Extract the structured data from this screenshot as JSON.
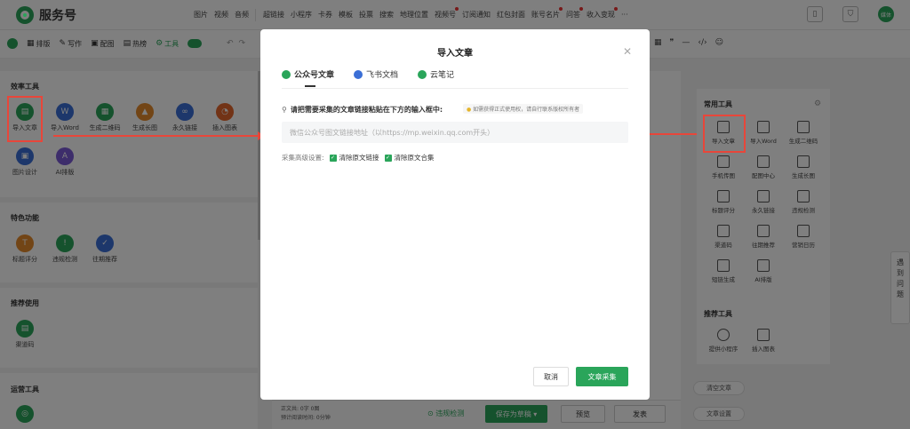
{
  "app": {
    "brand": "服务号"
  },
  "top_menu": [
    "图片",
    "视频",
    "音频",
    "超链接",
    "小程序",
    "卡券",
    "模板",
    "投票",
    "搜索",
    "地理位置",
    "视频号",
    "订阅通知",
    "红包封面",
    "账号名片",
    "问答",
    "收入变现",
    "···"
  ],
  "user": {
    "avatar_text": "媒体"
  },
  "toolbar2": {
    "items": [
      "排版",
      "写作",
      "配图",
      "热榜",
      "工具"
    ]
  },
  "left_panel": {
    "section1_title": "效率工具",
    "section1_tools": [
      "导入文章",
      "导入Word",
      "生成二维码",
      "生成长图",
      "永久链接",
      "插入图表",
      "图片设计",
      "AI排版"
    ],
    "section2_title": "特色功能",
    "section2_tools": [
      "标题评分",
      "违规检测",
      "往期推荐"
    ],
    "section3_title": "推荐使用",
    "section3_tools": [
      "渠道码"
    ],
    "section4_title": "运营工具"
  },
  "right_panel": {
    "title": "常用工具",
    "tools": [
      "导入文章",
      "导入Word",
      "生成二维码",
      "手机传图",
      "配图中心",
      "生成长图",
      "标题评分",
      "永久链接",
      "违规检测",
      "渠道码",
      "往期推荐",
      "营销日历",
      "短链生成",
      "AI排版"
    ],
    "recommend_title": "推荐工具",
    "recommend_tools": [
      "提供小程序",
      "插入图表"
    ],
    "btn_clear": "清空文章",
    "btn_settings": "文章设置"
  },
  "helper": "遇到问题",
  "footer": {
    "words": "正文共: 0字 0图",
    "read_time": "预计阅读时间: 0分钟",
    "check": "违规检测",
    "save": "保存为草稿",
    "preview": "预览",
    "publish": "发表"
  },
  "dialog": {
    "title": "导入文章",
    "tabs": [
      "公众号文章",
      "飞书文档",
      "云笔记"
    ],
    "prompt": "请把需要采集的文章链接粘贴在下方的输入框中:",
    "hint": "如需获得正式使用权，请自行联系版权所有者",
    "input_placeholder": "微信公众号图文链接地址（以https://mp.weixin.qq.com开头）",
    "input_value": "",
    "advanced_label": "采集高级设置:",
    "option1": "清除原文链接",
    "option2": "清除原文合集",
    "cancel": "取消",
    "collect": "文章采集"
  }
}
